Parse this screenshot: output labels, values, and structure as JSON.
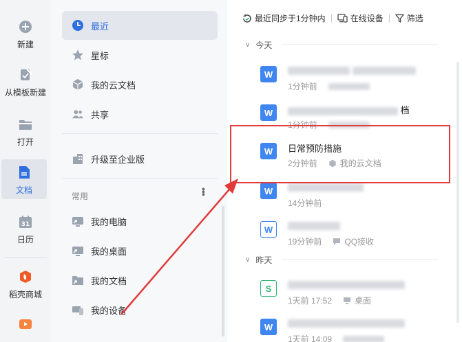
{
  "rail": {
    "items": [
      {
        "label": "新建",
        "icon": "plus-circle-icon"
      },
      {
        "label": "从模板新建",
        "icon": "template-icon"
      },
      {
        "label": "打开",
        "icon": "folder-icon"
      },
      {
        "label": "文档",
        "icon": "document-icon",
        "active": true
      },
      {
        "label": "日历",
        "icon": "calendar-icon",
        "day": "31"
      },
      {
        "label": "稻壳商城",
        "icon": "docer-icon"
      }
    ]
  },
  "nav": {
    "items": [
      {
        "label": "最近",
        "icon": "clock-icon",
        "active": true
      },
      {
        "label": "星标",
        "icon": "star-icon"
      },
      {
        "label": "我的云文档",
        "icon": "cloud-doc-icon"
      },
      {
        "label": "共享",
        "icon": "share-icon"
      },
      {
        "label": "升级至企业版",
        "icon": "enterprise-icon"
      }
    ],
    "section_label": "常用",
    "frequent": [
      {
        "label": "我的电脑",
        "icon": "computer-shortcut-icon"
      },
      {
        "label": "我的桌面",
        "icon": "desktop-shortcut-icon"
      },
      {
        "label": "我的文档",
        "icon": "folder-shortcut-icon"
      },
      {
        "label": "我的设备",
        "icon": "device-icon"
      }
    ]
  },
  "toolbar": {
    "sync": "最近同步于1分钟内",
    "devices": "在线设备",
    "filter": "筛选"
  },
  "groups": {
    "today": "今天",
    "yesterday": "昨天"
  },
  "files": [
    {
      "type": "w",
      "name": "",
      "time": "1分钟前",
      "location": ""
    },
    {
      "type": "w",
      "name": "档",
      "time": "1分钟前",
      "location": ""
    },
    {
      "type": "w",
      "name": "日常预防措施",
      "time": "2分钟前",
      "location": "我的云文档"
    },
    {
      "type": "w",
      "name": "",
      "time": "14分钟前",
      "location": ""
    },
    {
      "type": "w-out",
      "name": "",
      "time": "19分钟前",
      "location": "QQ接收"
    },
    {
      "type": "s-out",
      "name": "",
      "time": "1天前 17:52",
      "location": "桌面"
    },
    {
      "type": "w",
      "name": "",
      "time": "1天前 14:09",
      "location": ""
    }
  ],
  "colors": {
    "accent": "#2f6fe0",
    "highlight": "#e03a3a",
    "word": "#3f86f0",
    "sheet": "#2bb673"
  }
}
